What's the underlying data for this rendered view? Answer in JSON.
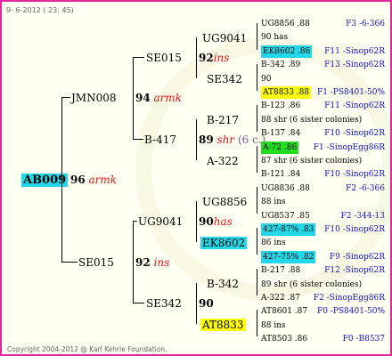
{
  "date": "9- 6-2012 ( 23: 45)",
  "copyright": "Copyright 2004-2012 @ Karl Kehrle Foundation.",
  "root": {
    "name": "AB009",
    "num": "96",
    "tag": "armk"
  },
  "g1": [
    {
      "name": "JMN008",
      "num": "94",
      "tag": "armk"
    },
    {
      "name": "SE015",
      "num": "92",
      "tag": "ins"
    }
  ],
  "g2": [
    {
      "name": "SE015",
      "num": "92",
      "tag": "ins"
    },
    {
      "name": "B-417",
      "num": "89",
      "tag": "shr",
      "extra": "(6 c.)"
    },
    {
      "name": "UG9041",
      "num": "90",
      "tag": "has"
    },
    {
      "name": "SE342",
      "num": "90",
      "tag": ""
    }
  ],
  "g3": [
    {
      "name": "UG9041",
      "num": "90",
      "tag": "has"
    },
    {
      "name": "SE342",
      "num": "90",
      "tag": ""
    },
    {
      "name": "B-217",
      "num": "88",
      "tag": "shr"
    },
    {
      "name": "A-322",
      "num": "87",
      "tag": "shr"
    },
    {
      "name": "UG8856",
      "num": "88",
      "tag": "ins"
    },
    {
      "name": "EK8602",
      "num": "86",
      "tag": "ins"
    },
    {
      "name": "B-342",
      "num": "89",
      "tag": "shr"
    },
    {
      "name": "AT8833",
      "num": "88",
      "tag": "ins"
    }
  ],
  "g4": [
    {
      "left": "UG8856 .88",
      "right": "F3 -6-366"
    },
    {
      "left": "90 has",
      "right": ""
    },
    {
      "left": "EK8602 .86",
      "right": "F11 -Sinop62R"
    },
    {
      "left": "B-342 .89",
      "right": "F13 -Sinop62R"
    },
    {
      "left": "90",
      "right": ""
    },
    {
      "left": "AT8833 .88",
      "right": "F1 -PS8401-50%"
    },
    {
      "left": "B-123 .86",
      "right": "F11 -Sinop62R"
    },
    {
      "left": "88 shr (6 sister colonies)",
      "right": ""
    },
    {
      "left": "B-137 .84",
      "right": "F10 -Sinop62R"
    },
    {
      "left": "A-72 .86",
      "right": "F1 -SinopEgg86R"
    },
    {
      "left": "87 shr (6 sister colonies)",
      "right": ""
    },
    {
      "left": "B-121 .84",
      "right": "F10 -Sinop62R"
    },
    {
      "left": "UG8836 .88",
      "right": "F2 -6-366"
    },
    {
      "left": "88 ins",
      "right": ""
    },
    {
      "left": "UG8537 .85",
      "right": "F2 -344-13"
    },
    {
      "left": "427-87% .83",
      "right": "F10 -Sinop62R"
    },
    {
      "left": "86 ins",
      "right": ""
    },
    {
      "left": "427-75% .82",
      "right": "F9 -Sinop62R"
    },
    {
      "left": "B-217 .88",
      "right": "F12 -Sinop62R"
    },
    {
      "left": "89 shr (6 sister colonies)",
      "right": ""
    },
    {
      "left": "A-322 .87",
      "right": "F2 -SinopEgg86R"
    },
    {
      "left": "AT8601 .87",
      "right": "F0 -PS8401-50%"
    },
    {
      "left": "88 ins",
      "right": ""
    },
    {
      "left": "AT8503 .86",
      "right": "F0 -B8537"
    }
  ]
}
